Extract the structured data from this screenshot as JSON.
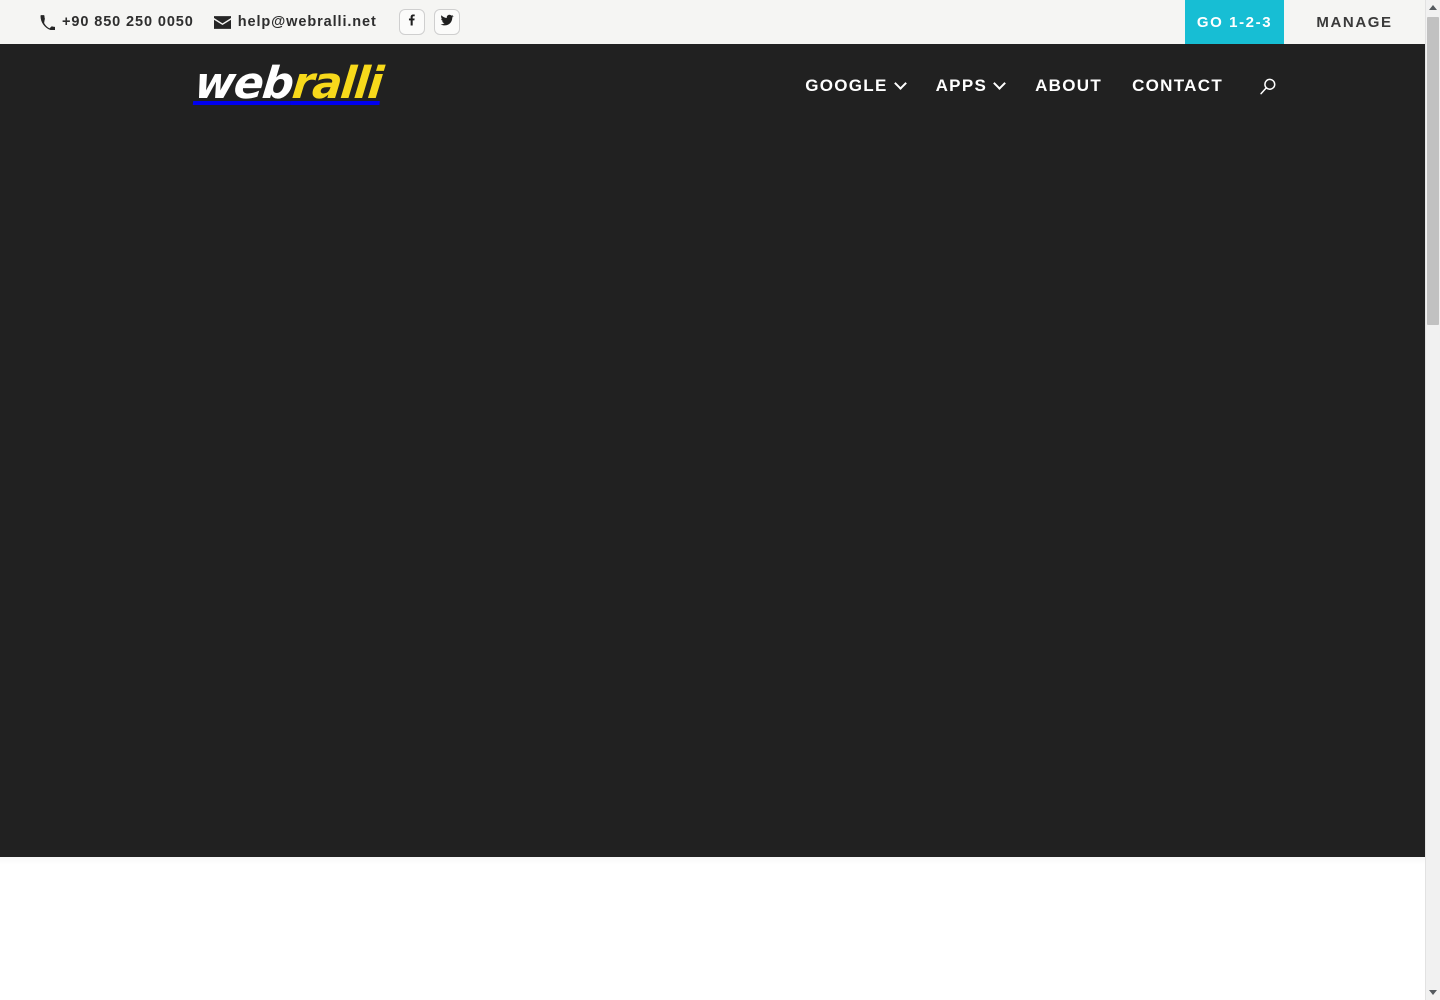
{
  "topbar": {
    "phone": {
      "icon": "phone-icon",
      "text": "+90 850 250 0050"
    },
    "email": {
      "icon": "envelope-icon",
      "text": "help@webralli.net"
    },
    "social": [
      {
        "icon": "facebook-icon",
        "label": "f"
      },
      {
        "icon": "twitter-icon",
        "label": "t"
      }
    ],
    "go_button": {
      "label": "GO 1-2-3",
      "background": "#17bed4",
      "text_color": "#ffffff"
    },
    "manage_button": {
      "label": "MANAGE",
      "background": "#f5f5f3",
      "text_color": "#3a3a3a"
    },
    "background": "#f5f5f3"
  },
  "header": {
    "logo": {
      "full_text": "webralli",
      "part_light": "web",
      "part_accent": "ralli",
      "light_color": "#ffffff",
      "accent_color": "#f7d91b"
    },
    "background": "#212121",
    "nav": [
      {
        "label": "GOOGLE",
        "has_dropdown": true,
        "chevron": "chevron-down-icon"
      },
      {
        "label": "APPS",
        "has_dropdown": true,
        "chevron": "chevron-down-icon"
      },
      {
        "label": "ABOUT",
        "has_dropdown": false
      },
      {
        "label": "CONTACT",
        "has_dropdown": false
      }
    ],
    "search": {
      "icon": "search-icon"
    }
  },
  "hero": {
    "background": "#212121",
    "content": ""
  },
  "below_section": {
    "background": "#ffffff"
  },
  "scrollbar": {
    "up_arrow": "scroll-up-arrow-icon",
    "down_arrow": "scroll-down-arrow-icon",
    "track_color": "#f1f1f1",
    "thumb_color": "#c1c1c1"
  }
}
